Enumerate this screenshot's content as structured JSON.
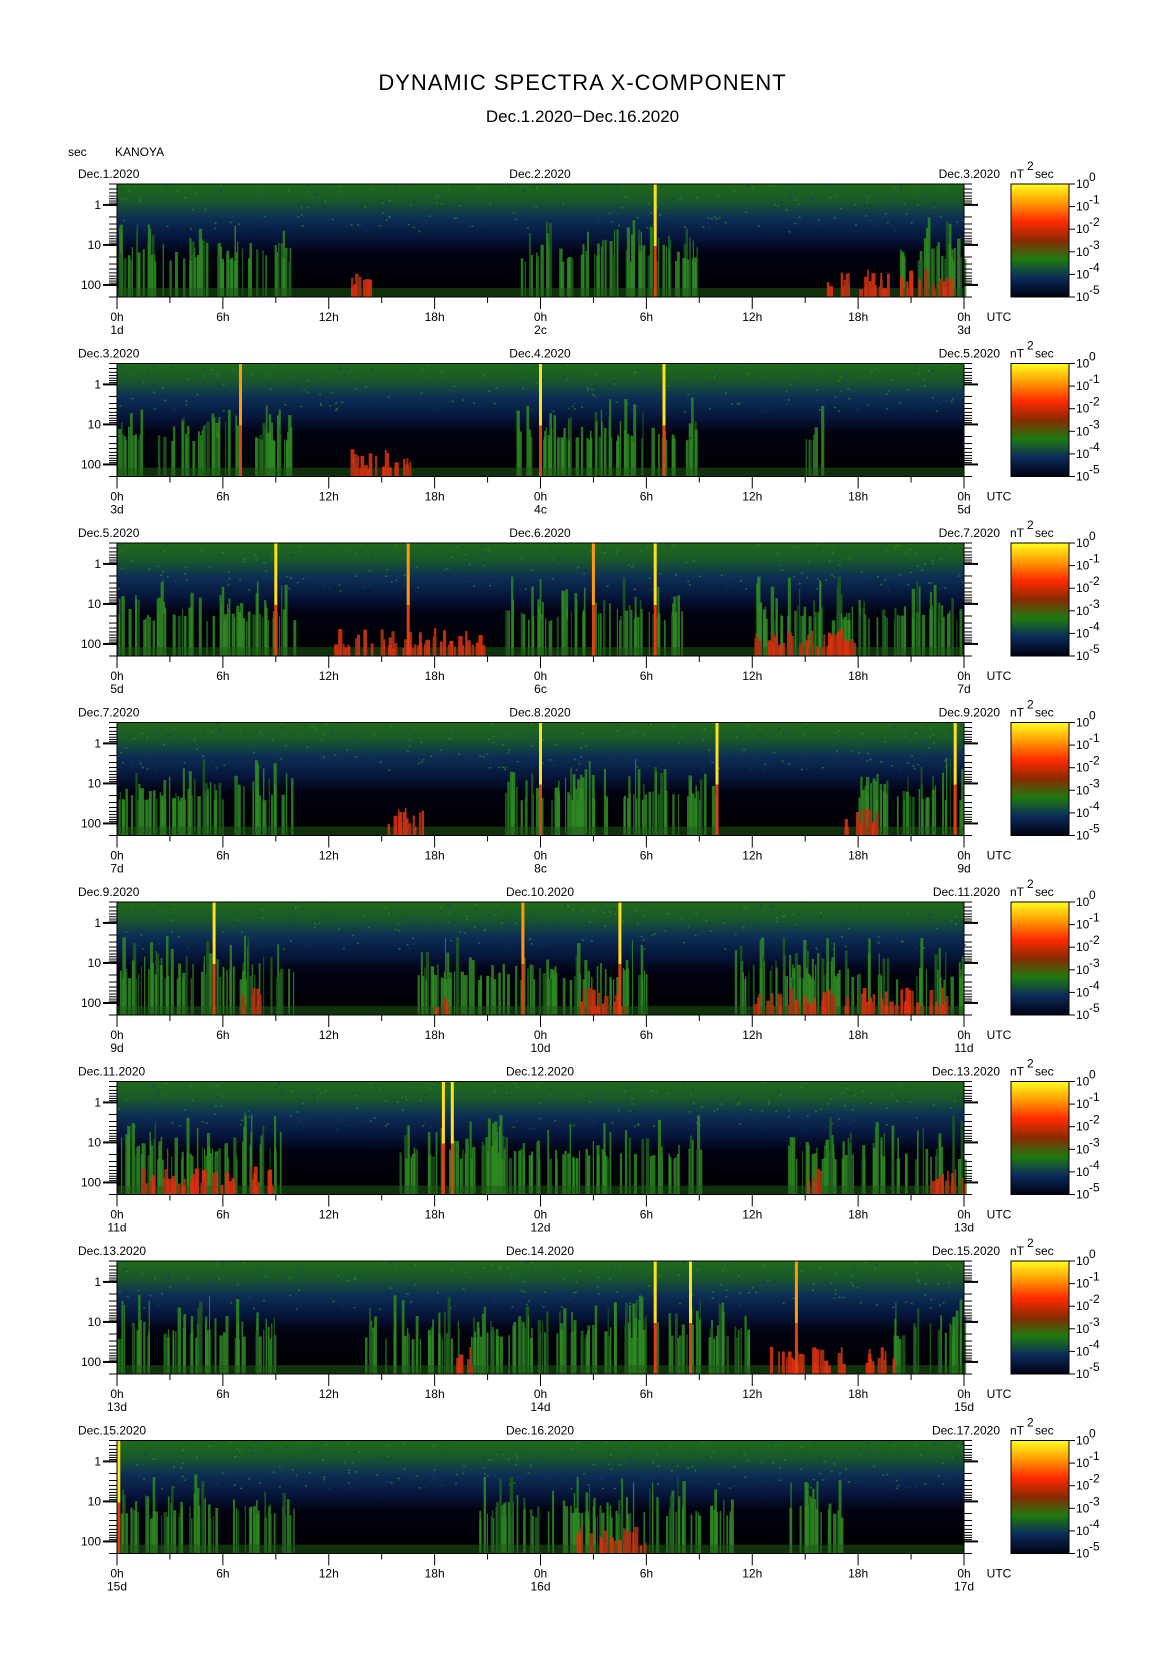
{
  "chart_data": {
    "type": "heatmap",
    "title": "DYNAMIC SPECTRA X-COMPONENT",
    "subtitle": "Dec.1.2020−Dec.16.2020",
    "ylabel": "sec",
    "station": "KANOYA",
    "y_scale": "log",
    "y_ticks": [
      "1",
      "10",
      "100"
    ],
    "y_tick_values": [
      1,
      10,
      100
    ],
    "ylim": [
      0.3,
      200
    ],
    "x_ticks": [
      "0h",
      "6h",
      "12h",
      "18h",
      "0h",
      "6h",
      "12h",
      "18h",
      "0h"
    ],
    "x_end_label": "UTC",
    "colorbar": {
      "unit_parts": [
        "nT",
        "2",
        "sec"
      ],
      "tick_values": [
        "10",
        "10",
        "10",
        "10",
        "10",
        "10"
      ],
      "tick_exponents": [
        "0",
        "-1",
        "-2",
        "-3",
        "-4",
        "-5"
      ],
      "colors": [
        "#ffff20",
        "#ff9a00",
        "#ff2a00",
        "#8a2a00",
        "#1e7a10",
        "#0a2a5a",
        "#000010"
      ]
    },
    "panels": [
      {
        "left_date": "Dec.1.2020",
        "mid_date": "Dec.2.2020",
        "right_date": "Dec.3.2020",
        "day_labels": [
          "1d",
          "2c",
          "3d"
        ],
        "spikes": [
          30.5
        ],
        "strong_spikes": [
          30.5
        ],
        "active_from": [
          0,
          22.5
        ],
        "active_to": [
          10,
          33
        ],
        "late_activity": [
          44,
          48
        ],
        "red_bursts": [
          [
            13,
            14.5
          ],
          [
            40,
            47.5
          ]
        ]
      },
      {
        "left_date": "Dec.3.2020",
        "mid_date": "Dec.4.2020",
        "right_date": "Dec.5.2020",
        "day_labels": [
          "3d",
          "4c",
          "5d"
        ],
        "spikes": [
          7,
          24,
          31
        ],
        "strong_spikes": [
          24,
          31
        ],
        "active_from": [
          0,
          22.5
        ],
        "active_to": [
          10,
          33
        ],
        "late_activity": [
          39,
          40
        ],
        "red_bursts": [
          [
            13,
            17
          ]
        ]
      },
      {
        "left_date": "Dec.5.2020",
        "mid_date": "Dec.6.2020",
        "right_date": "Dec.7.2020",
        "day_labels": [
          "5d",
          "6c",
          "7d"
        ],
        "spikes": [
          9,
          16.5,
          27,
          30.5
        ],
        "strong_spikes": [
          9,
          30.5
        ],
        "active_from": [
          0,
          22,
          36
        ],
        "active_to": [
          10,
          32,
          48
        ],
        "late_activity": [],
        "red_bursts": [
          [
            12,
            21
          ],
          [
            36,
            42
          ],
          [
            38,
            42
          ]
        ]
      },
      {
        "left_date": "Dec.7.2020",
        "mid_date": "Dec.8.2020",
        "right_date": "Dec.9.2020",
        "day_labels": [
          "7d",
          "8c",
          "9d"
        ],
        "spikes": [
          24,
          34,
          47.5
        ],
        "strong_spikes": [
          24,
          34,
          47.5
        ],
        "active_from": [
          0,
          22
        ],
        "active_to": [
          10,
          34
        ],
        "late_activity": [
          42,
          48
        ],
        "red_bursts": [
          [
            15,
            17.5
          ],
          [
            41,
            43
          ]
        ]
      },
      {
        "left_date": "Dec.9.2020",
        "mid_date": "Dec.10.2020",
        "right_date": "Dec.11.2020",
        "day_labels": [
          "9d",
          "10d",
          "11d"
        ],
        "spikes": [
          5.5,
          23,
          28.5
        ],
        "strong_spikes": [
          5.5,
          28.5
        ],
        "active_from": [
          0,
          17,
          35
        ],
        "active_to": [
          10,
          30,
          48
        ],
        "late_activity": [],
        "red_bursts": [
          [
            7,
            8
          ],
          [
            18,
            19
          ],
          [
            26,
            29
          ],
          [
            36,
            47
          ]
        ]
      },
      {
        "left_date": "Dec.11.2020",
        "mid_date": "Dec.12.2020",
        "right_date": "Dec.13.2020",
        "day_labels": [
          "11d",
          "12d",
          "13d"
        ],
        "spikes": [
          18.5,
          19
        ],
        "strong_spikes": [
          18.5,
          19
        ],
        "active_from": [
          0,
          16
        ],
        "active_to": [
          10,
          33
        ],
        "late_activity": [
          38,
          48
        ],
        "red_bursts": [
          [
            1,
            9
          ],
          [
            39,
            40
          ],
          [
            46,
            48
          ]
        ]
      },
      {
        "left_date": "Dec.13.2020",
        "mid_date": "Dec.14.2020",
        "right_date": "Dec.15.2020",
        "day_labels": [
          "13d",
          "14d",
          "15d"
        ],
        "spikes": [
          30.5,
          32.5,
          38.5
        ],
        "strong_spikes": [
          30.5,
          32.5
        ],
        "active_from": [
          0,
          14
        ],
        "active_to": [
          9,
          36
        ],
        "late_activity": [
          44,
          48
        ],
        "red_bursts": [
          [
            19,
            20
          ],
          [
            37,
            44
          ]
        ]
      },
      {
        "left_date": "Dec.15.2020",
        "mid_date": "Dec.16.2020",
        "right_date": "Dec.17.2020",
        "day_labels": [
          "15d",
          "16d",
          "17d"
        ],
        "spikes": [
          0.1
        ],
        "strong_spikes": [
          0.1
        ],
        "active_from": [
          0,
          20
        ],
        "active_to": [
          10,
          35
        ],
        "late_activity": [
          38,
          41
        ],
        "red_bursts": [
          [
            26,
            30
          ]
        ]
      }
    ]
  }
}
